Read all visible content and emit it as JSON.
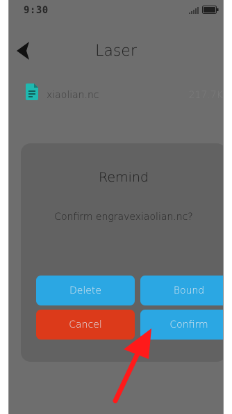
{
  "status_bar": {
    "time": "9:30",
    "signal_icon": "signal-bars-icon",
    "battery_icon": "battery-icon"
  },
  "nav": {
    "back_icon": "back-arrow-icon",
    "title": "Laser"
  },
  "file": {
    "icon": "document-icon",
    "name": "xiaolian.nc",
    "size": "217.7KB"
  },
  "dialog": {
    "title": "Remind",
    "message": "Confirm engravexiaolian.nc?",
    "buttons": {
      "delete": "Delete",
      "bound": "Bound",
      "cancel": "Cancel",
      "confirm": "Confirm"
    }
  },
  "annotation": {
    "icon": "red-pointer-arrow-icon",
    "color": "#ff1a1a"
  },
  "colors": {
    "overlay_background": "#6e6e6e",
    "dialog_background": "#626262",
    "button_blue": "#2ba7e3",
    "button_red": "#dc3a1a",
    "file_icon": "#1fb9b0"
  }
}
